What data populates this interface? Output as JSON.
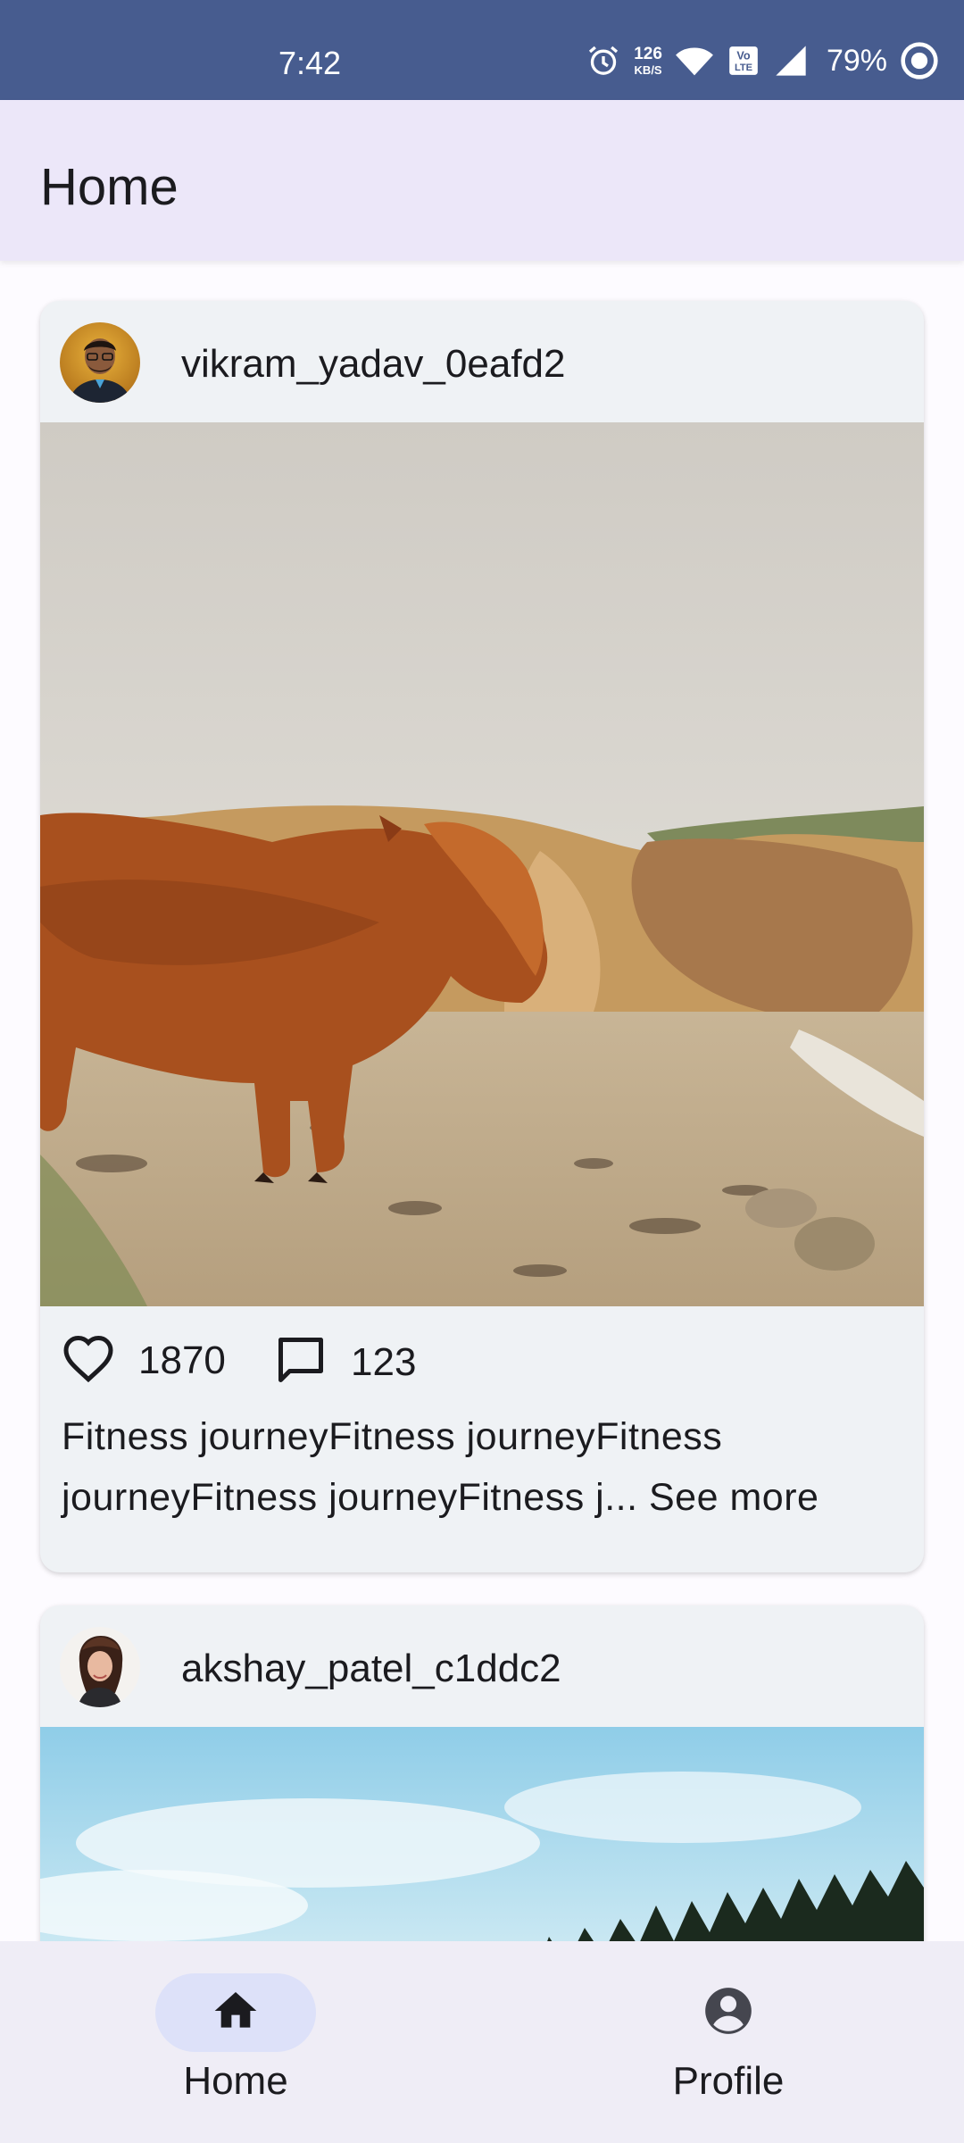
{
  "status_bar": {
    "time": "7:42",
    "net_speed_value": "126",
    "net_speed_unit": "KB/S",
    "battery": "79%",
    "icons": [
      "alarm-icon",
      "wifi-icon",
      "volte-icon",
      "signal-icon",
      "battery-icon"
    ]
  },
  "app_bar": {
    "title": "Home"
  },
  "posts": [
    {
      "username": "vikram_yadav_0eafd2",
      "likes": "1870",
      "comments": "123",
      "caption": "Fitness journeyFitness journeyFitness journeyFitness journeyFitness j...",
      "see_more": "See more"
    },
    {
      "username": "akshay_patel_c1ddc2"
    }
  ],
  "bottom_nav": {
    "items": [
      {
        "label": "Home",
        "icon": "home-icon",
        "active": true
      },
      {
        "label": "Profile",
        "icon": "account-circle-icon",
        "active": false
      }
    ]
  },
  "colors": {
    "status_bar": "#475c8f",
    "app_bar": "#ece7f9",
    "card": "#eff2f5",
    "nav_bar": "#efedf6",
    "nav_active": "#dde1f9"
  }
}
